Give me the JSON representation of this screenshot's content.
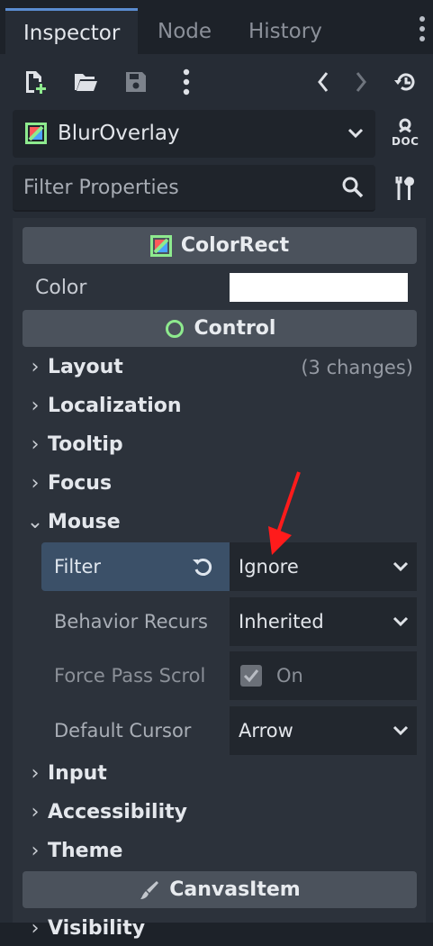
{
  "tabs": [
    {
      "label": "Inspector",
      "active": true
    },
    {
      "label": "Node",
      "active": false
    },
    {
      "label": "History",
      "active": false
    }
  ],
  "toolbar": {
    "icons": [
      "new-resource-icon",
      "open-folder-icon",
      "save-icon",
      "more-vertical-icon",
      "back-chevron-icon",
      "forward-chevron-icon",
      "history-icon"
    ]
  },
  "object_selector": {
    "value": "BlurOverlay",
    "doc_label": "DOC"
  },
  "filter": {
    "placeholder": "Filter Properties"
  },
  "colorrect": {
    "category": "ColorRect",
    "color_label": "Color",
    "color_value": "#ffffff"
  },
  "control": {
    "category": "Control",
    "sections": [
      {
        "label": "Layout",
        "expanded": false,
        "note": "(3 changes)"
      },
      {
        "label": "Localization",
        "expanded": false
      },
      {
        "label": "Tooltip",
        "expanded": false
      },
      {
        "label": "Focus",
        "expanded": false
      },
      {
        "label": "Mouse",
        "expanded": true
      }
    ],
    "mouse_props": [
      {
        "label": "Filter",
        "value": "Ignore",
        "selected": true
      },
      {
        "label": "Behavior Recurs",
        "value": "Inherited"
      },
      {
        "label": "Force Pass Scrol",
        "value": "On",
        "checked": true
      },
      {
        "label": "Default Cursor",
        "value": "Arrow"
      }
    ],
    "after_sections": [
      {
        "label": "Input"
      },
      {
        "label": "Accessibility"
      },
      {
        "label": "Theme"
      }
    ]
  },
  "canvasitem": {
    "category": "CanvasItem",
    "next_section": "Visibility"
  },
  "colors": {
    "accent": "#5a8cd0",
    "selected_row": "#3b5068",
    "annotation_arrow": "#ff1b1b",
    "control_icon": "#8eea8e"
  }
}
